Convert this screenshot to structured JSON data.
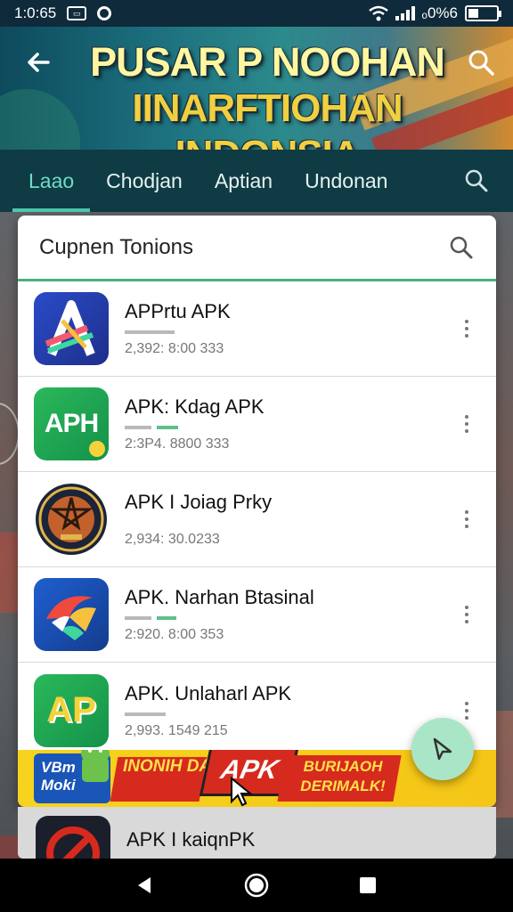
{
  "status_bar": {
    "time": "1:0:65",
    "battery_text": "ₒ0%6",
    "battery_level": 0.35,
    "icons": [
      "notification-box-icon",
      "sync-circle-icon",
      "wifi-icon",
      "signal-icon",
      "battery-icon"
    ]
  },
  "header": {
    "title_line1": "PUSAR P NOOHAN",
    "title_line2": "IINARFTIOHAN INDONSIA",
    "back_icon": "arrow-left-icon",
    "search_icon": "search-icon"
  },
  "tabs": [
    {
      "label": "Laao",
      "active": true
    },
    {
      "label": "Chodjan",
      "active": false
    },
    {
      "label": "Aptian",
      "active": false
    },
    {
      "label": "Undonan",
      "active": false
    }
  ],
  "card": {
    "title": "Cupnen Tonions",
    "items": [
      {
        "name": "APPrtu APK",
        "meta": "2,392: 8:00 333"
      },
      {
        "name": "APK: Kdag APK",
        "meta": "2:3P4. 8800 333"
      },
      {
        "name": "APK I Joiag Prky",
        "meta": "2,934: 30.0233"
      },
      {
        "name": "APK. Narhan Btasinal",
        "meta": "2:920. 8:00 353"
      },
      {
        "name": "APK. Unlaharl APK",
        "meta": "2,993. 1549 215"
      }
    ],
    "icon_labels": {
      "aph": "APH",
      "ap": "AP"
    }
  },
  "ad": {
    "left_text": "VBm Moki",
    "text1": "INONIH DAURIBE",
    "apk": "APK",
    "text2": "BURIJAOH DERIMALK!"
  },
  "below_item": {
    "name": "APK I kaiqnPK"
  },
  "nav": {
    "back_icon": "nav-back-icon",
    "home_icon": "nav-home-icon",
    "recents_icon": "nav-recents-icon"
  },
  "colors": {
    "accent": "#4fc8b0",
    "tab_bar": "#0f3b44",
    "divider_green": "#4ab07e",
    "ad_yellow": "#f7d21e",
    "ad_red": "#d62a1e"
  }
}
